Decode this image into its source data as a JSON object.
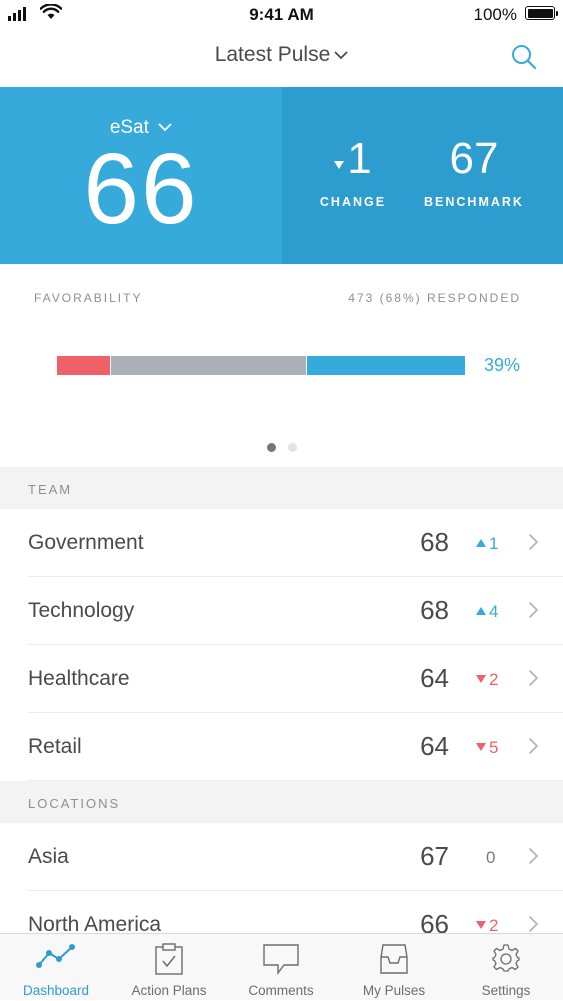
{
  "status_bar": {
    "time": "9:41 AM",
    "battery": "100%"
  },
  "nav": {
    "title": "Latest Pulse"
  },
  "hero": {
    "metric_label": "eSat",
    "metric_value": "66",
    "change_value": "1",
    "change_label": "CHANGE",
    "benchmark_value": "67",
    "benchmark_label": "BENCHMARK"
  },
  "favorability": {
    "label": "FAVORABILITY",
    "responded": "473 (68%) RESPONDED",
    "negative_fraction": 0.13,
    "neutral_fraction": 0.48,
    "positive_fraction": 0.39,
    "positive_label": "39%",
    "page_count": 2,
    "active_page": 0
  },
  "team": {
    "header": "TEAM",
    "rows": [
      {
        "name": "Government",
        "score": "68",
        "direction": "up",
        "delta": "1"
      },
      {
        "name": "Technology",
        "score": "68",
        "direction": "up",
        "delta": "4"
      },
      {
        "name": "Healthcare",
        "score": "64",
        "direction": "down",
        "delta": "2"
      },
      {
        "name": "Retail",
        "score": "64",
        "direction": "down",
        "delta": "5"
      }
    ]
  },
  "locations": {
    "header": "LOCATIONS",
    "rows": [
      {
        "name": "Asia",
        "score": "67",
        "direction": "flat",
        "delta": "0"
      },
      {
        "name": "North America",
        "score": "66",
        "direction": "down",
        "delta": "2"
      }
    ]
  },
  "tabs": [
    {
      "label": "Dashboard",
      "icon": "line-chart-icon",
      "active": true
    },
    {
      "label": "Action Plans",
      "icon": "clipboard-check-icon",
      "active": false
    },
    {
      "label": "Comments",
      "icon": "speech-bubble-icon",
      "active": false
    },
    {
      "label": "My Pulses",
      "icon": "inbox-tray-icon",
      "active": false
    },
    {
      "label": "Settings",
      "icon": "gear-icon",
      "active": false
    }
  ],
  "colors": {
    "accent": "#36abdb",
    "accent_dark": "#2d9ccf",
    "negative": "#ef6068",
    "neutral": "#acb0b7"
  }
}
